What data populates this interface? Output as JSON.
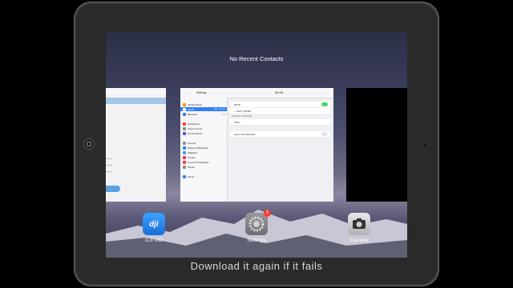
{
  "overlay_caption": "Download it again if it fails",
  "app_switcher": {
    "recent_contacts": "No Recent Contacts",
    "dock_apps": [
      {
        "label": "DJI GO",
        "icon": "dji-go-icon"
      },
      {
        "label": "Settings",
        "icon": "settings-icon",
        "badge": "1"
      },
      {
        "label": "Camera",
        "icon": "camera-icon"
      }
    ]
  },
  "settings_card": {
    "sidebar_title": "Settings",
    "detail_title": "WLAN",
    "sidebar_items": [
      {
        "label": "Airplane Mode",
        "color": "#ff9500"
      },
      {
        "label": "WLAN",
        "value": "FAST_507960",
        "color": "#2f7ff6",
        "selected": true
      },
      {
        "label": "Bluetooth",
        "value": "Off",
        "color": "#2f7ff6"
      },
      {
        "label": "Notifications",
        "color": "#ff3b30"
      },
      {
        "label": "Control Center",
        "color": "#8e8e93"
      },
      {
        "label": "Do Not Disturb",
        "color": "#5856d6"
      },
      {
        "label": "General",
        "color": "#8e8e93"
      },
      {
        "label": "Display & Brightness",
        "color": "#2f7ff6"
      },
      {
        "label": "Wallpaper",
        "color": "#34aadc"
      },
      {
        "label": "Sounds",
        "color": "#ff2d55"
      },
      {
        "label": "Touch ID & Passcode",
        "color": "#ff3b30"
      },
      {
        "label": "Privacy",
        "color": "#8e8e93"
      },
      {
        "label": "iCloud",
        "color": "#2f7ff6"
      }
    ],
    "wlan_row": "WLAN",
    "network_name": "FAST_507960",
    "choose_network": "CHOOSE A NETWORK...",
    "other_row": "Other...",
    "ask_to_join": "Ask to Join Networks"
  }
}
